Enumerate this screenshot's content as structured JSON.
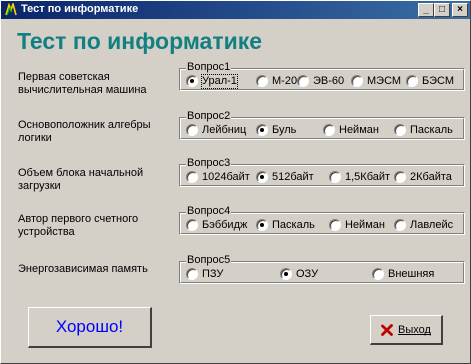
{
  "window": {
    "title": "Тест по информатике",
    "minimize_label": "_",
    "maximize_label": "□",
    "close_label": "×",
    "app_icon": "app-icon"
  },
  "heading": "Тест по информатике",
  "questions": [
    {
      "label": "Первая советская вычислительная машина",
      "group": "Вопрос1",
      "options": [
        "Урал-1",
        "М-20",
        "ЭВ-60",
        "МЭСМ",
        "БЭСМ"
      ],
      "selected": "Урал-1"
    },
    {
      "label": "Основоположник алгебры логики",
      "group": "Вопрос2",
      "options": [
        "Лейбниц",
        "Буль",
        "Нейман",
        "Паскаль"
      ],
      "selected": "Буль"
    },
    {
      "label": "Объем блока начальной загрузки",
      "group": "Вопрос3",
      "options": [
        "1024байт",
        "512байт",
        "1,5Кбайт",
        "2Кбайта"
      ],
      "selected": "512байт"
    },
    {
      "label": "Автор первого счетного устройства",
      "group": "Вопрос4",
      "options": [
        "Бэббидж",
        "Паскаль",
        "Нейман",
        "Лавлейс"
      ],
      "selected": "Паскаль"
    },
    {
      "label": "Энергозависимая память",
      "group": "Вопрос5",
      "options": [
        "ПЗУ",
        "ОЗУ",
        "Внешняя"
      ],
      "selected": "ОЗУ"
    }
  ],
  "result_button": {
    "label": "Хорошо!",
    "color": "#0000ff"
  },
  "exit_button": {
    "label": "Выход",
    "icon": "red-x-icon"
  },
  "colors": {
    "heading": "#128080",
    "titlebar_start": "#0a246a",
    "titlebar_end": "#3a6ea5"
  }
}
